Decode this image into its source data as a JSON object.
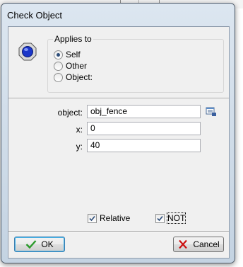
{
  "window": {
    "title": "Check Object"
  },
  "applies_to": {
    "legend": "Applies to",
    "options": [
      {
        "label": "Self",
        "selected": true
      },
      {
        "label": "Other",
        "selected": false
      },
      {
        "label": "Object:",
        "selected": false
      }
    ]
  },
  "fields": {
    "object": {
      "label": "object:",
      "value": "obj_fence"
    },
    "x": {
      "label": "x:",
      "value": "0"
    },
    "y": {
      "label": "y:",
      "value": "40"
    }
  },
  "checkboxes": {
    "relative": {
      "label": "Relative",
      "checked": true
    },
    "not": {
      "label": "NOT",
      "checked": true
    }
  },
  "buttons": {
    "ok": "OK",
    "cancel": "Cancel"
  },
  "colors": {
    "ok_check": "#2a9a2a",
    "cancel_x": "#cc1111",
    "action_icon_blue": "#1b36c9"
  },
  "icons": [
    "action-object-icon",
    "object-menu-icon",
    "ok-check-icon",
    "cancel-x-icon"
  ]
}
